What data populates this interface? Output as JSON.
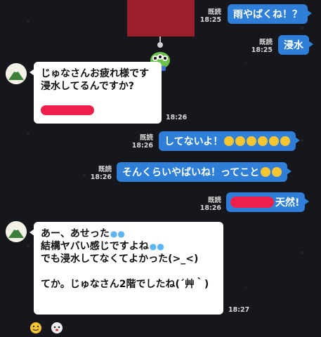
{
  "chat": {
    "messages": [
      {
        "id": "m1",
        "direction": "out",
        "text": "雨やばくね！？",
        "read": "既読",
        "time": "18:25"
      },
      {
        "id": "m2",
        "direction": "out",
        "text": "浸水",
        "read": "既読",
        "time": "18:25"
      },
      {
        "id": "m3",
        "direction": "in",
        "lines": [
          "じゅなさんお疲れ様です",
          "浸水してるんですか?"
        ],
        "time": "18:26"
      },
      {
        "id": "m4",
        "direction": "out",
        "text": "してないよ！",
        "read": "既読",
        "time": "18:26",
        "emoji_count": 6
      },
      {
        "id": "m5",
        "direction": "out",
        "text": "そんくらいやばいね！ってこと",
        "read": "既読",
        "time": "18:26",
        "emoji_count": 2
      },
      {
        "id": "m6",
        "direction": "out",
        "text": "天然!",
        "read": "既読",
        "time": "18:26"
      },
      {
        "id": "m7",
        "direction": "in",
        "lines": [
          "あー、あせった",
          "結構ヤバい感じですよね",
          "でも浸水してなくてよかった(>_<)",
          "",
          "てか。じゅなさん2階でしたね(´艸｀)"
        ],
        "time": "18:27"
      }
    ]
  },
  "colors": {
    "background": "#16171c",
    "outgoing_bubble": "#2f7fd8",
    "incoming_bubble": "#ffffff",
    "redaction": "#ee1f4a",
    "shared_image": "#9a1f2a"
  },
  "icons": {
    "avatar": "mountain-avatar-icon",
    "sticker": "alien-sticker-icon",
    "emoji": "laughing-emoji-icon",
    "sweat": "sweat-drops-icon",
    "reaction_smile": "smiley-reaction-icon",
    "reaction_face": "face-reaction-icon"
  }
}
